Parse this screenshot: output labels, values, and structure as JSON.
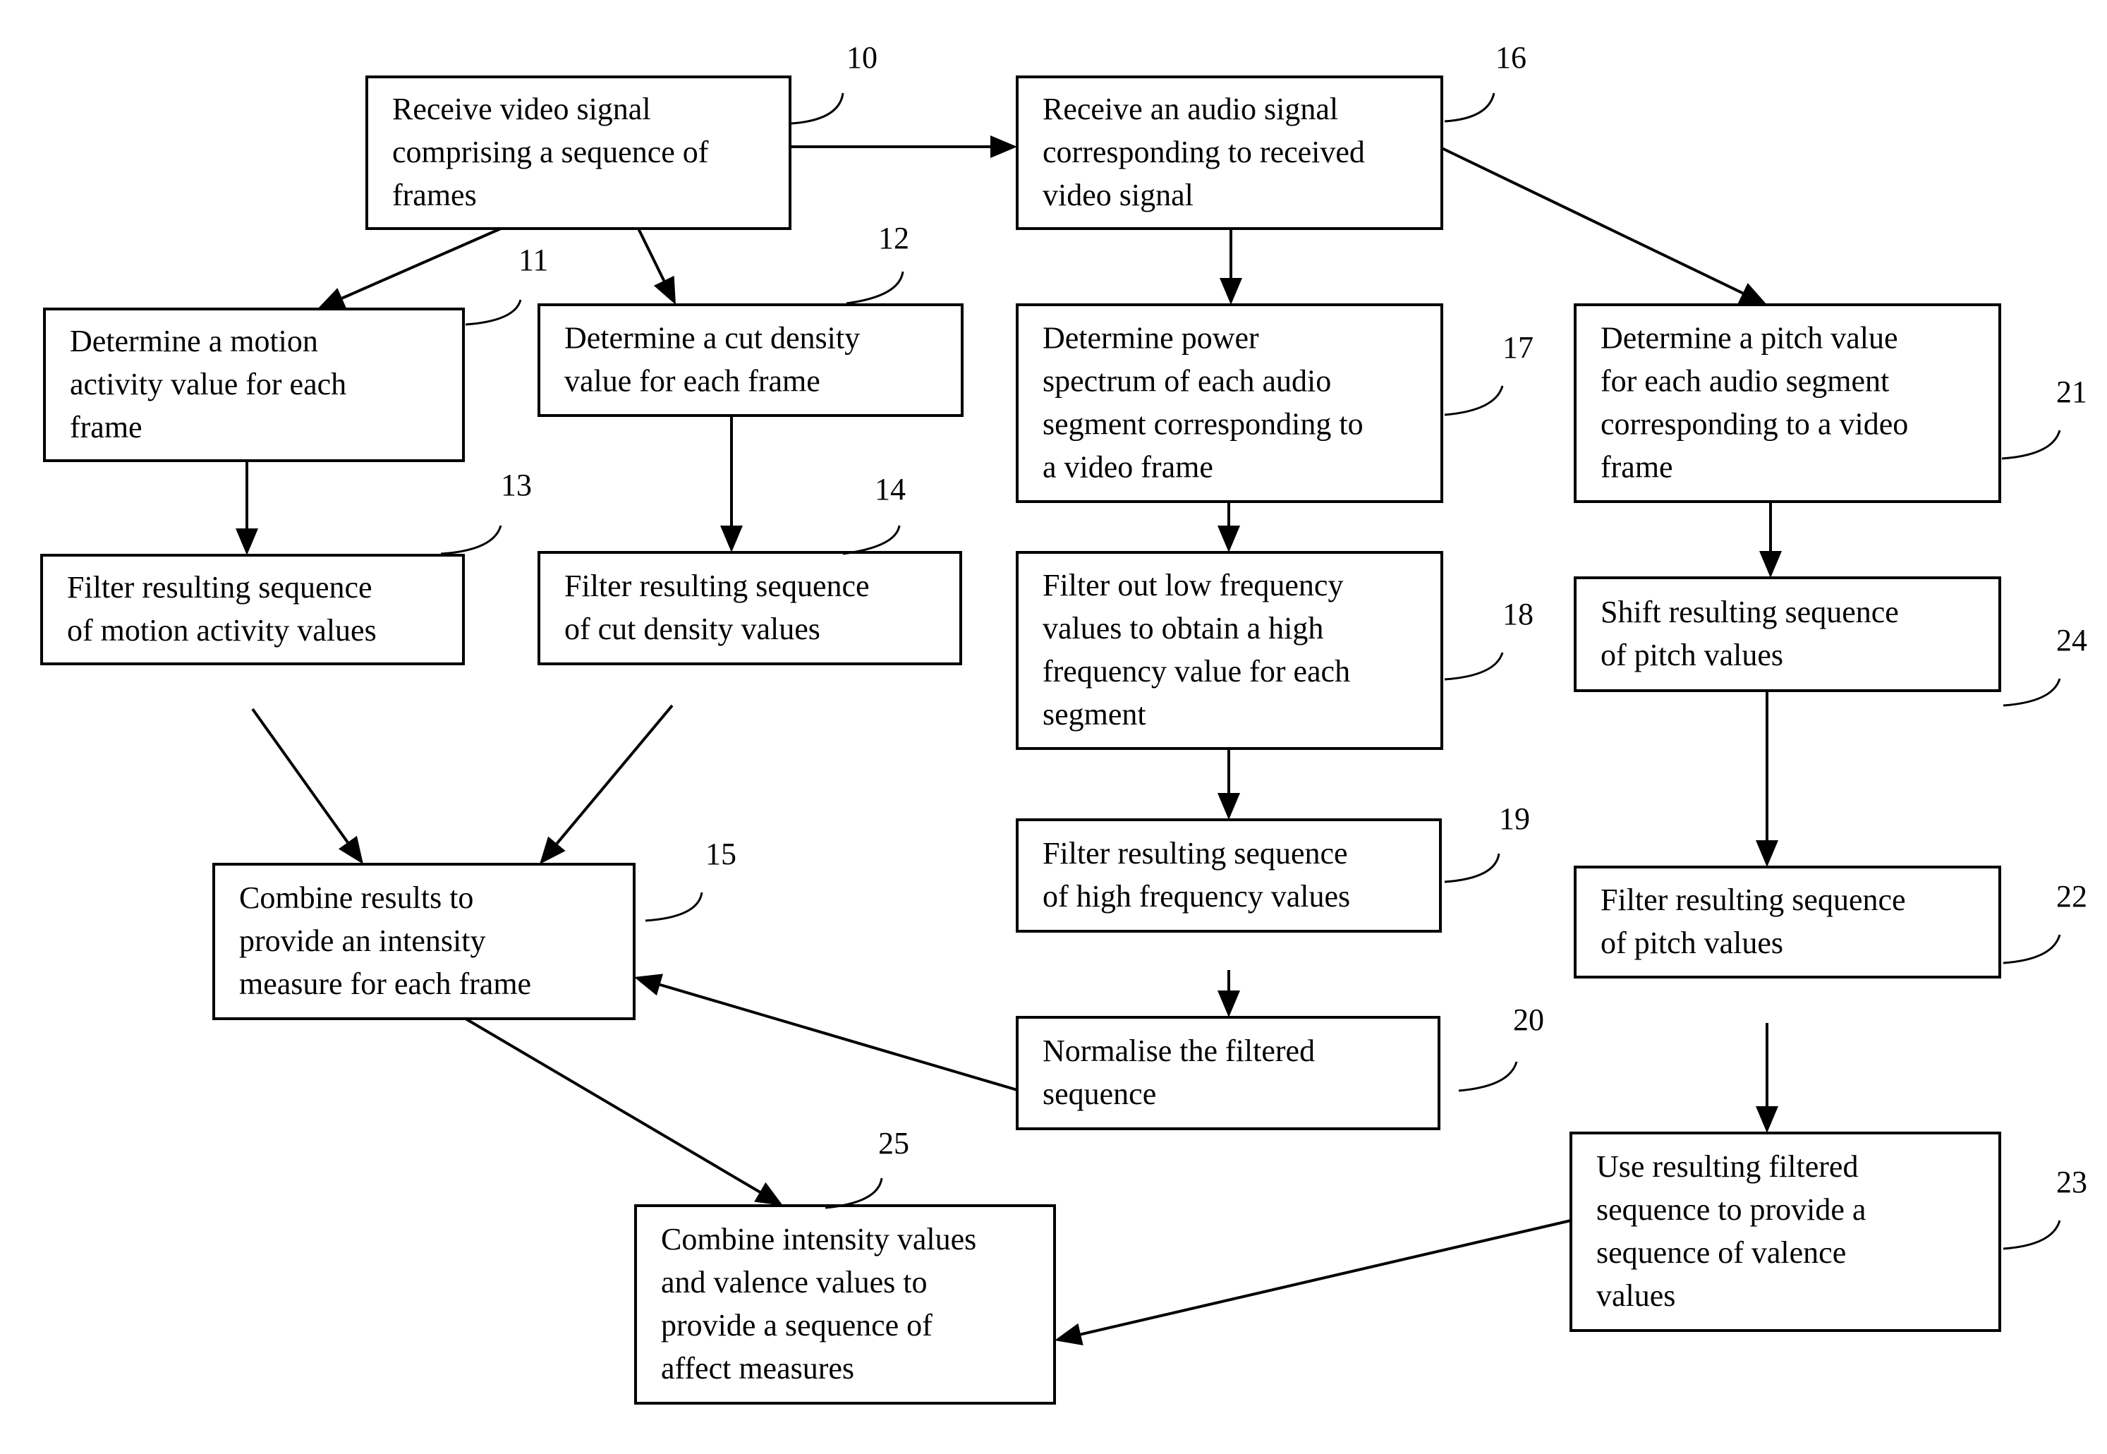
{
  "diagram": {
    "type": "flowchart",
    "nodes": [
      {
        "id": "10",
        "label": "10",
        "lines": [
          "Receive video signal",
          "comprising a sequence of",
          "frames"
        ]
      },
      {
        "id": "16",
        "label": "16",
        "lines": [
          "Receive an audio signal",
          "corresponding to received",
          "video signal"
        ]
      },
      {
        "id": "11",
        "label": "11",
        "lines": [
          "Determine a motion",
          "activity value for each",
          "frame"
        ]
      },
      {
        "id": "12",
        "label": "12",
        "lines": [
          "Determine a cut density",
          "value for each frame"
        ]
      },
      {
        "id": "17",
        "label": "17",
        "lines": [
          "Determine power",
          "spectrum of each audio",
          "segment corresponding to",
          "a video frame"
        ]
      },
      {
        "id": "21",
        "label": "21",
        "lines": [
          "Determine a pitch value",
          "for each audio segment",
          "corresponding to a video",
          "frame"
        ]
      },
      {
        "id": "13",
        "label": "13",
        "lines": [
          "Filter resulting sequence",
          "of motion activity values"
        ]
      },
      {
        "id": "14",
        "label": "14",
        "lines": [
          "Filter resulting sequence",
          "of cut density values"
        ]
      },
      {
        "id": "18",
        "label": "18",
        "lines": [
          "Filter out low frequency",
          "values to obtain a high",
          "frequency value for each",
          "segment"
        ]
      },
      {
        "id": "24",
        "label": "24",
        "lines": [
          "Shift resulting sequence",
          "of pitch values"
        ]
      },
      {
        "id": "19",
        "label": "19",
        "lines": [
          "Filter resulting sequence",
          "of high frequency values"
        ]
      },
      {
        "id": "22",
        "label": "22",
        "lines": [
          "Filter resulting sequence",
          "of pitch values"
        ]
      },
      {
        "id": "15",
        "label": "15",
        "lines": [
          "Combine results to",
          "provide an intensity",
          "measure for each frame"
        ]
      },
      {
        "id": "20",
        "label": "20",
        "lines": [
          "Normalise the filtered",
          "sequence"
        ]
      },
      {
        "id": "23",
        "label": "23",
        "lines": [
          "Use resulting filtered",
          "sequence to provide a",
          "sequence of valence",
          "values"
        ]
      },
      {
        "id": "25",
        "label": "25",
        "lines": [
          "Combine intensity values",
          "and valence values to",
          "provide a sequence of",
          "affect measures"
        ]
      }
    ],
    "edges": [
      {
        "from": "10",
        "to": "16"
      },
      {
        "from": "10",
        "to": "11"
      },
      {
        "from": "10",
        "to": "12"
      },
      {
        "from": "16",
        "to": "17"
      },
      {
        "from": "16",
        "to": "21"
      },
      {
        "from": "11",
        "to": "13"
      },
      {
        "from": "12",
        "to": "14"
      },
      {
        "from": "17",
        "to": "18"
      },
      {
        "from": "21",
        "to": "24"
      },
      {
        "from": "13",
        "to": "15"
      },
      {
        "from": "14",
        "to": "15"
      },
      {
        "from": "18",
        "to": "19"
      },
      {
        "from": "24",
        "to": "22"
      },
      {
        "from": "19",
        "to": "20"
      },
      {
        "from": "22",
        "to": "23"
      },
      {
        "from": "20",
        "to": "15"
      },
      {
        "from": "15",
        "to": "25"
      },
      {
        "from": "23",
        "to": "25"
      }
    ]
  }
}
